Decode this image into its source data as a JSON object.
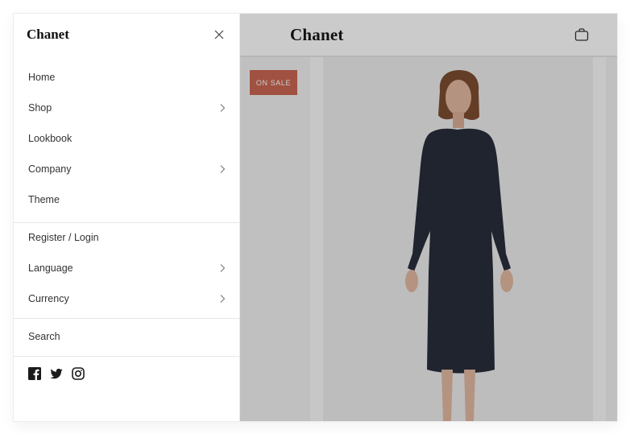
{
  "site": {
    "brand": "Chanet"
  },
  "drawer": {
    "brand": "Chanet",
    "primary_menu": [
      {
        "label": "Home",
        "has_submenu": false
      },
      {
        "label": "Shop",
        "has_submenu": true
      },
      {
        "label": "Lookbook",
        "has_submenu": false
      },
      {
        "label": "Company",
        "has_submenu": true
      },
      {
        "label": "Theme",
        "has_submenu": false
      }
    ],
    "secondary_menu": [
      {
        "label": "Register / Login",
        "has_submenu": false
      },
      {
        "label": "Language",
        "has_submenu": true
      },
      {
        "label": "Currency",
        "has_submenu": true
      }
    ],
    "search_label": "Search",
    "social_icons": [
      "facebook-icon",
      "twitter-icon",
      "instagram-icon"
    ]
  },
  "product": {
    "badge": "ON SALE"
  },
  "colors": {
    "badge": "#c9634f",
    "overlay": "rgba(20,20,20,0.22)",
    "dress": "#252a36",
    "text": "#333333"
  }
}
